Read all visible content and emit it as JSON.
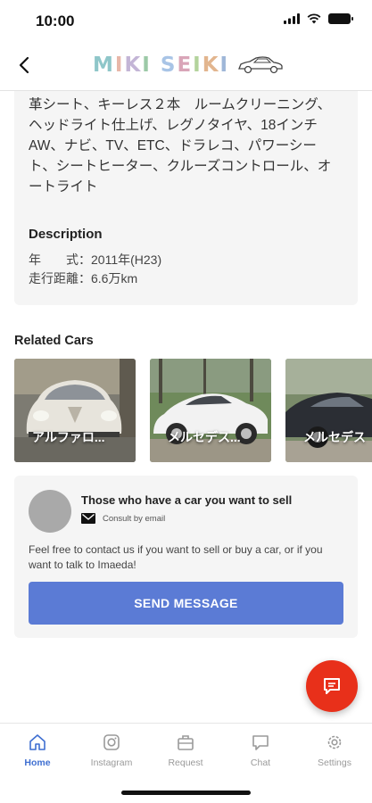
{
  "status_bar": {
    "time": "10:00"
  },
  "header": {
    "logo_text": "MIKI SEIKI"
  },
  "features": {
    "text": "革シート、キーレス２本　ルームクリーニング、ヘッドライト仕上げ、レグノタイヤ、18インチAW、ナビ、TV、ETC、ドラレコ、パワーシート、シートヒーター、クルーズコントロール、オートライト"
  },
  "description": {
    "title": "Description",
    "lines": [
      "年　　式：2011年(H23)",
      "走行距離：6.6万km"
    ]
  },
  "related": {
    "title": "Related Cars",
    "cars": [
      {
        "name": "アルファロ...",
        "color": "#e7e4dc"
      },
      {
        "name": "メルセデス...",
        "color": "#f2f2f2"
      },
      {
        "name": "メルセデス",
        "color": "#2b2e34"
      }
    ]
  },
  "contact": {
    "title": "Those who have a car you want to sell",
    "email_label": "Consult by email",
    "body": "Feel free to contact us if you want to sell or buy a car, or if you want to talk to Imaeda!",
    "button_label": "SEND MESSAGE"
  },
  "tabs": [
    {
      "label": "Home",
      "icon": "home-icon",
      "active": true
    },
    {
      "label": "Instagram",
      "icon": "instagram-icon",
      "active": false
    },
    {
      "label": "Request",
      "icon": "briefcase-icon",
      "active": false
    },
    {
      "label": "Chat",
      "icon": "chat-icon",
      "active": false
    },
    {
      "label": "Settings",
      "icon": "gear-icon",
      "active": false
    }
  ],
  "colors": {
    "accent": "#3f6fd1",
    "button": "#5b7bd5",
    "fab": "#e8301a",
    "card_bg": "#f5f5f5"
  }
}
